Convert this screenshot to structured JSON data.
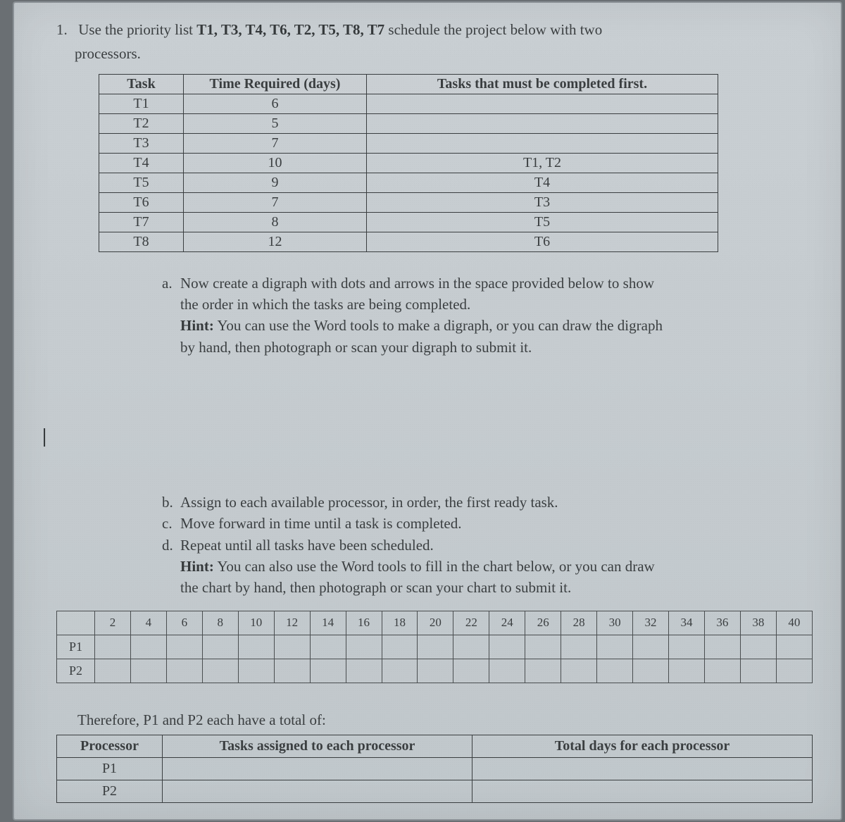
{
  "question": {
    "number": "1.",
    "line1_pre": "Use the priority list ",
    "priority_list": "T1, T3, T4, T6, T2, T5, T8, T7",
    "line1_post": " schedule the project below with two",
    "line2": "processors."
  },
  "task_table": {
    "headers": [
      "Task",
      "Time Required (days)",
      "Tasks that must be completed first."
    ],
    "rows": [
      {
        "task": "T1",
        "time": "6",
        "prereq": ""
      },
      {
        "task": "T2",
        "time": "5",
        "prereq": ""
      },
      {
        "task": "T3",
        "time": "7",
        "prereq": ""
      },
      {
        "task": "T4",
        "time": "10",
        "prereq": "T1, T2"
      },
      {
        "task": "T5",
        "time": "9",
        "prereq": "T4"
      },
      {
        "task": "T6",
        "time": "7",
        "prereq": "T3"
      },
      {
        "task": "T7",
        "time": "8",
        "prereq": "T5"
      },
      {
        "task": "T8",
        "time": "12",
        "prereq": "T6"
      }
    ]
  },
  "parts": {
    "a": {
      "label": "a.",
      "l1": "Now create a digraph with dots and arrows in the space provided below to show",
      "l2": "the order in which the tasks are being completed.",
      "hint_label": "Hint:",
      "hint1": " You can use the Word tools to make a digraph, or you can draw the digraph",
      "hint2": "by hand, then photograph or scan your digraph to submit it."
    },
    "b": {
      "label": "b.",
      "text": "Assign to each available processor, in order, the first ready task."
    },
    "c": {
      "label": "c.",
      "text": "Move forward in time until a task is completed."
    },
    "d": {
      "label": "d.",
      "text": "Repeat until all tasks have been scheduled.",
      "hint_label": "Hint:",
      "hint1": " You can also use the Word tools to fill in the chart below, or you can draw",
      "hint2": "the chart by hand, then photograph or scan your chart to submit it."
    }
  },
  "schedule": {
    "time_headers": [
      "2",
      "4",
      "6",
      "8",
      "10",
      "12",
      "14",
      "16",
      "18",
      "20",
      "22",
      "24",
      "26",
      "28",
      "30",
      "32",
      "34",
      "36",
      "38",
      "40"
    ],
    "rows": [
      "P1",
      "P2"
    ]
  },
  "therefore": "Therefore, P1 and P2 each have a total of:",
  "totals": {
    "headers": [
      "Processor",
      "Tasks assigned to each processor",
      "Total days for each processor"
    ],
    "rows": [
      "P1",
      "P2"
    ]
  },
  "cursor": "|"
}
